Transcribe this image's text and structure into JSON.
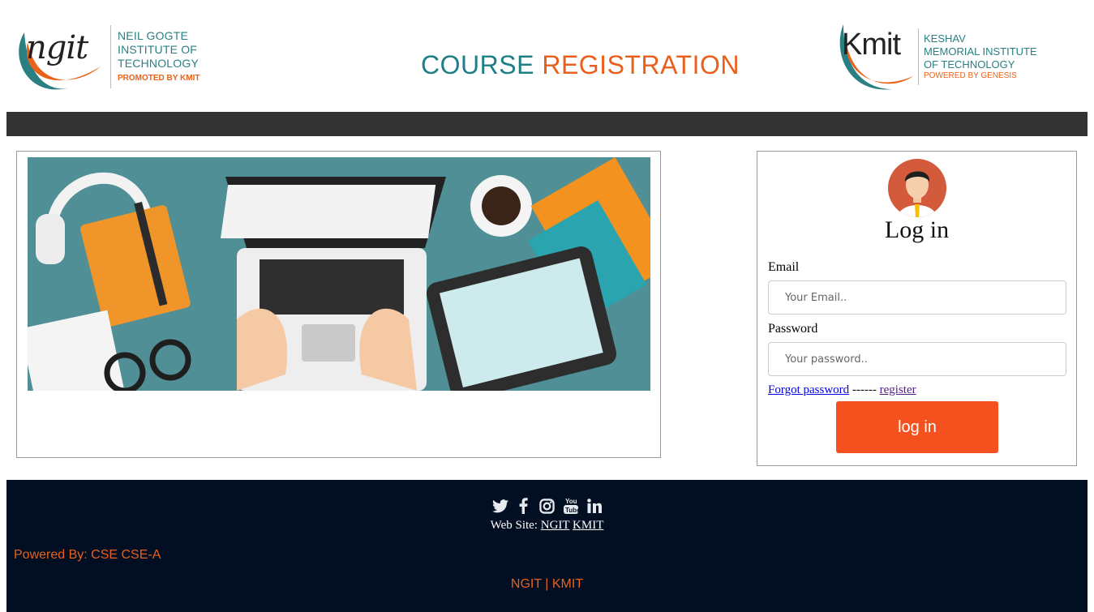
{
  "header": {
    "title_part1": "COURSE",
    "title_part2": "REGISTRATION",
    "ngit_logo": {
      "mark": "ngit",
      "line1": "NEIL GOGTE",
      "line2": "INSTITUTE OF",
      "line3": "TECHNOLOGY",
      "tagline": "PROMOTED BY KMIT"
    },
    "kmit_logo": {
      "mark": "Kmit",
      "line1": "KESHAV",
      "line2": "MEMORIAL INSTITUTE",
      "line3": "OF TECHNOLOGY",
      "tagline": "POWERED BY GENESIS"
    }
  },
  "login": {
    "heading": "Log in",
    "email_label": "Email",
    "email_placeholder": "Your Email..",
    "password_label": "Password",
    "password_placeholder": "Your password..",
    "forgot_link": "Forgot password",
    "separator": "------",
    "register_link": " register",
    "button_label": "log in"
  },
  "footer": {
    "social_icons": [
      "twitter-icon",
      "facebook-icon",
      "instagram-icon",
      "youtube-icon",
      "linkedin-icon"
    ],
    "website_label": "Web Site:",
    "website_links": [
      "NGIT",
      "KMIT"
    ],
    "powered_by": "Powered By: CSE CSE-A",
    "bottom_line": "NGIT | KMIT"
  },
  "colors": {
    "teal": "#1f7f86",
    "orange": "#e8601c",
    "button": "#f4511e",
    "dark_bar": "#333333",
    "footer_bg": "#020f23"
  }
}
